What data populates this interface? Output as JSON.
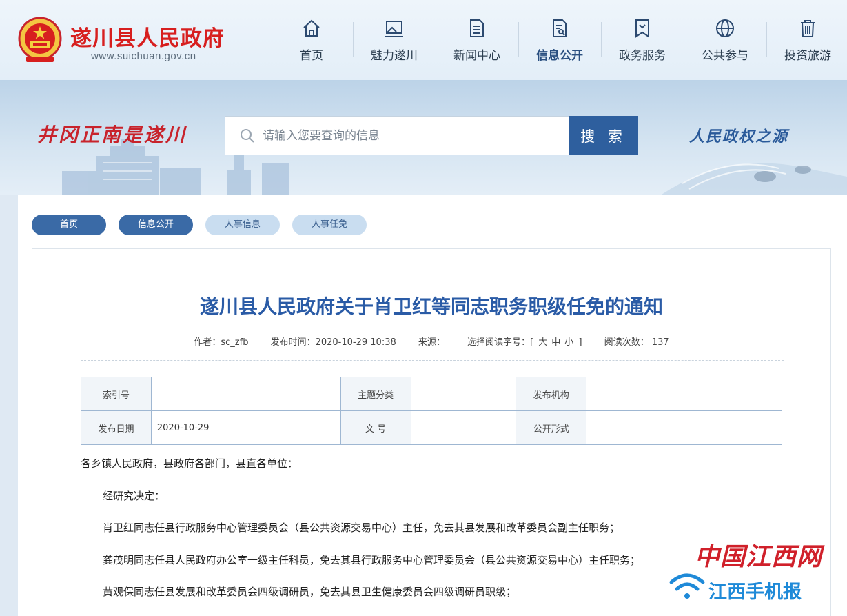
{
  "header": {
    "site_title": "遂川县人民政府",
    "site_url": "www.suichuan.gov.cn",
    "nav": [
      {
        "label": "首页",
        "icon": "home-icon"
      },
      {
        "label": "魅力遂川",
        "icon": "landscape-icon"
      },
      {
        "label": "新闻中心",
        "icon": "document-icon"
      },
      {
        "label": "信息公开",
        "icon": "file-search-icon",
        "active": true
      },
      {
        "label": "政务服务",
        "icon": "bookmark-icon"
      },
      {
        "label": "公共参与",
        "icon": "globe-icon"
      },
      {
        "label": "投资旅游",
        "icon": "trash-icon"
      }
    ]
  },
  "banner": {
    "slogan_left": "井冈正南是遂川",
    "slogan_right": "人民政权之源",
    "search": {
      "placeholder": "请输入您要查询的信息",
      "button_label": "搜 索"
    }
  },
  "breadcrumb": [
    "首页",
    "信息公开",
    "人事信息",
    "人事任免"
  ],
  "article": {
    "title": "遂川县人民政府关于肖卫红等同志职务职级任免的通知",
    "meta": {
      "author": "作者：sc_zfb",
      "publish_time": "发布时间：2020-10-29 10:38",
      "source": "来源：",
      "font_size_label": "选择阅读字号：[",
      "font_size_options": [
        "大",
        "中",
        "小"
      ],
      "font_size_end": "]",
      "read_count": "阅读次数： 137"
    },
    "info_table": {
      "row1": {
        "l1": "索引号",
        "v1": "",
        "l2": "主题分类",
        "v2": "",
        "l3": "发布机构",
        "v3": ""
      },
      "row2": {
        "l1": "发布日期",
        "v1": "2020-10-29",
        "l2": "文 号",
        "v2": "",
        "l3": "公开形式",
        "v3": ""
      }
    },
    "paragraphs": [
      "各乡镇人民政府，县政府各部门，县直各单位：",
      "经研究决定：",
      "肖卫红同志任县行政服务中心管理委员会（县公共资源交易中心）主任，免去其县发展和改革委员会副主任职务；",
      "龚茂明同志任县人民政府办公室一级主任科员，免去其县行政服务中心管理委员会（县公共资源交易中心）主任职务；",
      "黄观保同志任县发展和改革委员会四级调研员，免去其县卫生健康委员会四级调研员职级；"
    ]
  },
  "watermark": {
    "top": "中国江西网",
    "bottom": "江西手机报"
  },
  "colors": {
    "title_red": "#d71f1f",
    "nav_blue": "#2a4f80",
    "search_button": "#2e5f9e",
    "article_title": "#2a5ba6",
    "crumb_dark": "#3a6aa6",
    "crumb_light": "#c9ddf0"
  }
}
